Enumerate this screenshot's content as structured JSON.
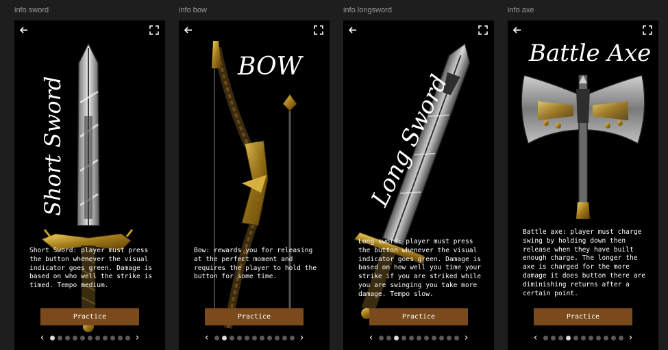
{
  "frames": [
    {
      "label": "info sword",
      "title": "Short Sword",
      "description": "Short Sword: player must press the button whenever the visual indicator goes green. Damage is based on who well the strike is timed. Tempo medium.",
      "button": "Practice",
      "active_page": 0
    },
    {
      "label": "info bow",
      "title": "BOW",
      "description": "Bow: rewards you for releasing at the perfect moment and requires the player to hold the button for some time.",
      "button": "Practice",
      "active_page": 1
    },
    {
      "label": "info longsword",
      "title": "Long Sword",
      "description": "Long sword: player must press the button whenever the visual indicator goes green. Damage is based on how well you time your strike if you are striked while you are swinging you take more damage. Tempo slow.",
      "button": "Practice",
      "active_page": 2
    },
    {
      "label": "info axe",
      "title": "Battle Axe",
      "description": "Battle axe: player must charge swing by holding down then release when they have built enough charge. The longer the axe is charged for the more damage it does button there are diminishing returns after a certain point.",
      "button": "Practice",
      "active_page": 3
    }
  ],
  "pager": {
    "prev": "‹",
    "next": "›",
    "count": 11
  },
  "icons": {
    "back": "back-arrow-icon",
    "expand": "fullscreen-icon",
    "prev": "chevron-left-icon",
    "next": "chevron-right-icon"
  },
  "colors": {
    "background": "#1e1e1e",
    "card": "#000000",
    "button": "#7a4a1c",
    "dot_active": "#dcdcdc",
    "dot_inactive": "#5a5a5a",
    "gold": "#c9a227"
  }
}
